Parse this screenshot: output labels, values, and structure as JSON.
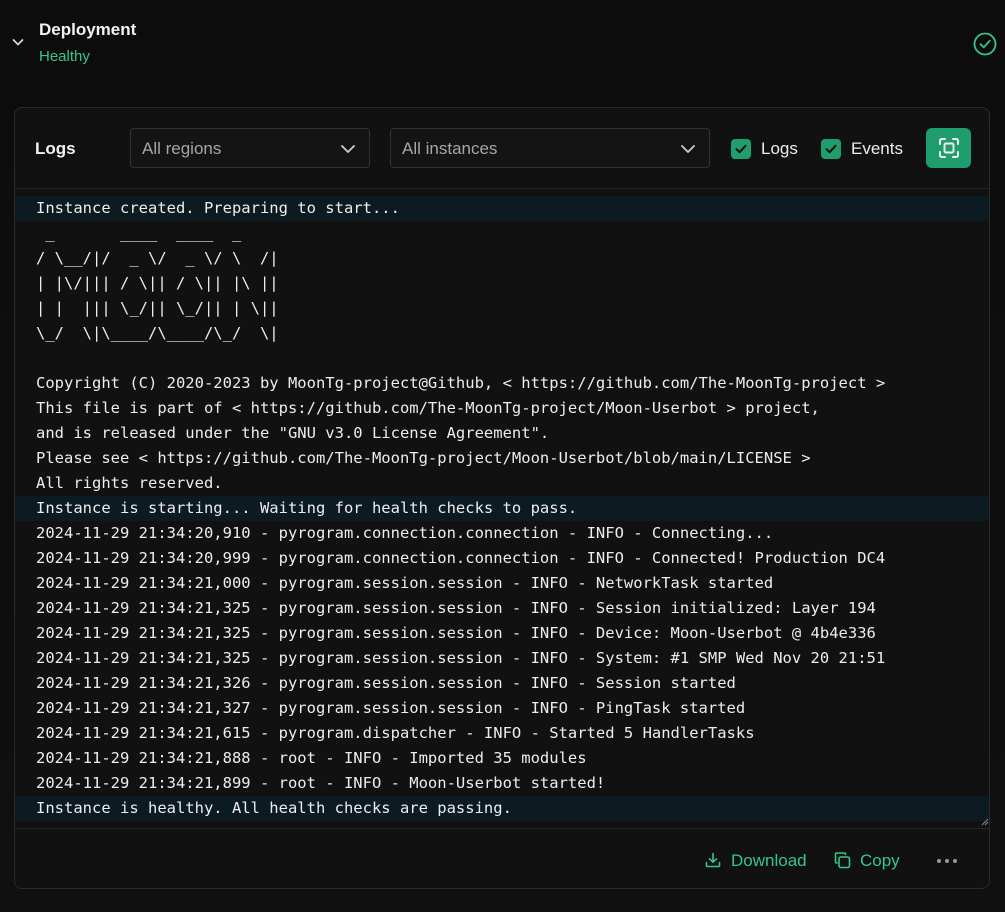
{
  "deployment": {
    "title": "Deployment",
    "status": "Healthy"
  },
  "logs_panel": {
    "title": "Logs",
    "region_select": "All regions",
    "instance_select": "All instances",
    "checkbox_logs": "Logs",
    "checkbox_events": "Events",
    "lines": [
      "Instance created. Preparing to start...",
      " _       ____  ____  _",
      "/ \\__/|/  _ \\/  _ \\/ \\  /|",
      "| |\\/||| / \\|| / \\|| |\\ ||",
      "| |  ||| \\_/|| \\_/|| | \\||",
      "\\_/  \\|\\____/\\____/\\_/  \\|",
      "",
      "Copyright (C) 2020-2023 by MoonTg-project@Github, < https://github.com/The-MoonTg-project >",
      "This file is part of < https://github.com/The-MoonTg-project/Moon-Userbot > project,",
      "and is released under the \"GNU v3.0 License Agreement\".",
      "Please see < https://github.com/The-MoonTg-project/Moon-Userbot/blob/main/LICENSE >",
      "All rights reserved.",
      "Instance is starting... Waiting for health checks to pass.",
      "2024-11-29 21:34:20,910 - pyrogram.connection.connection - INFO - Connecting...",
      "2024-11-29 21:34:20,999 - pyrogram.connection.connection - INFO - Connected! Production DC4",
      "2024-11-29 21:34:21,000 - pyrogram.session.session - INFO - NetworkTask started",
      "2024-11-29 21:34:21,325 - pyrogram.session.session - INFO - Session initialized: Layer 194",
      "2024-11-29 21:34:21,325 - pyrogram.session.session - INFO - Device: Moon-Userbot @ 4b4e336",
      "2024-11-29 21:34:21,325 - pyrogram.session.session - INFO - System: #1 SMP Wed Nov 20 21:51",
      "2024-11-29 21:34:21,326 - pyrogram.session.session - INFO - Session started",
      "2024-11-29 21:34:21,327 - pyrogram.session.session - INFO - PingTask started",
      "2024-11-29 21:34:21,615 - pyrogram.dispatcher - INFO - Started 5 HandlerTasks",
      "2024-11-29 21:34:21,888 - root - INFO - Imported 35 modules",
      "2024-11-29 21:34:21,899 - root - INFO - Moon-Userbot started!",
      "Instance is healthy. All health checks are passing."
    ],
    "download_label": "Download",
    "copy_label": "Copy"
  },
  "colors": {
    "accent": "#1f9d6c",
    "status_text": "#35c68b",
    "status_line_bg": "#0c1a22"
  }
}
